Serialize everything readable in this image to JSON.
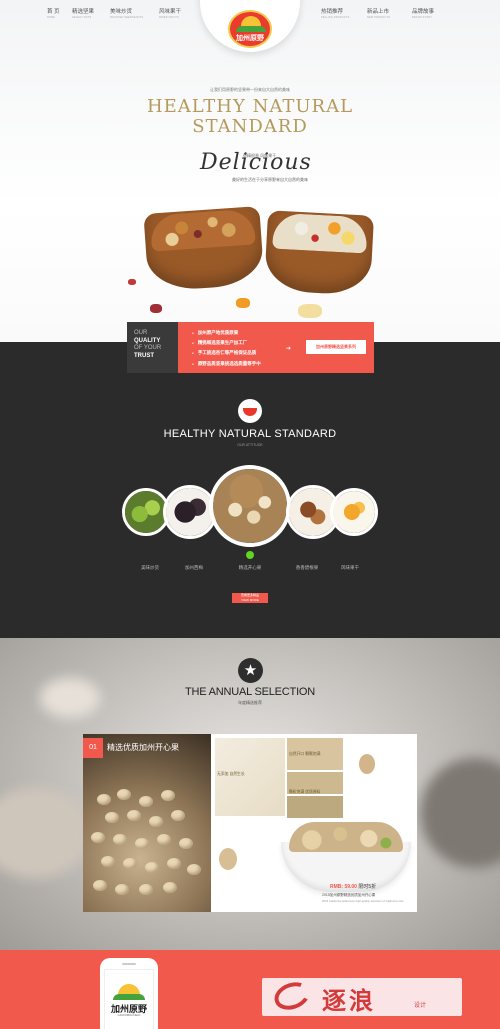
{
  "nav": {
    "left": [
      {
        "zh": "首 页",
        "en": "HOME"
      },
      {
        "zh": "精选坚果",
        "en": "SELECT NUTS"
      },
      {
        "zh": "美味炒货",
        "en": "ROASTED SEEDS&NUTS"
      },
      {
        "zh": "风味果干",
        "en": "DRIED FRUITS"
      }
    ],
    "right": [
      {
        "zh": "热销推荐",
        "en": "SELLING PRODUCTS"
      },
      {
        "zh": "新品上市",
        "en": "NEW PRODUCTS"
      },
      {
        "zh": "品牌故事",
        "en": "BRAND STORY"
      }
    ],
    "logo_brand": "加州原野"
  },
  "hero": {
    "kicker": "让我们用原野的坚果带一份来自大自然的美味",
    "title_line1": "HEALTHY NATURAL",
    "title_line2": "STANDARD",
    "script_word": "Delicious",
    "script_small1": "很精很香 风味果干",
    "script_small2": "美好的生活在于分享原野来自大自然的美味"
  },
  "quality": {
    "trust_lines": [
      "OUR",
      "QUALITY",
      "OF YOUR",
      "TRUST"
    ],
    "promo_items": [
      "加州原产地优质原果",
      "精挑细选坚果生产加工厂",
      "手工挑选杏仁等严格保证品质",
      "原野品质坚果挑选选质量等手中"
    ],
    "promo_button": "加州原野精选坚果系列"
  },
  "section2": {
    "title": "HEALTHY NATURAL STANDARD",
    "subtitle": "OUR ATTITUDE",
    "categories": [
      {
        "label": "美味炒货"
      },
      {
        "label": "加州西梅"
      },
      {
        "label": "精选开心果"
      },
      {
        "label": "香香碧根果"
      },
      {
        "label": "风味果干"
      }
    ],
    "viewmore_zh": "查看更多精品",
    "viewmore_en": "VIEW MORE"
  },
  "annual": {
    "title": "THE ANNUAL SELECTION",
    "subtitle": "年度精选推荐",
    "number": "01",
    "product_title": "精选优质加州开心果",
    "tiles": [
      "自然开口 颗颗饱满",
      "无添加 自然生长",
      "颗粒饱满 优质原料"
    ],
    "price_label": "RMB: 59.00",
    "discount": "限时5折",
    "desc": "2015加州原野精选优质加州开心果",
    "desc_en": "2015 California wilderness high-quality selection of California nuts"
  },
  "footer": {
    "phone_brand": "加州原野",
    "phone_brand_en": "CALIFORNIA FIELD",
    "watermark": "逐浪",
    "watermark_small": "设计"
  }
}
